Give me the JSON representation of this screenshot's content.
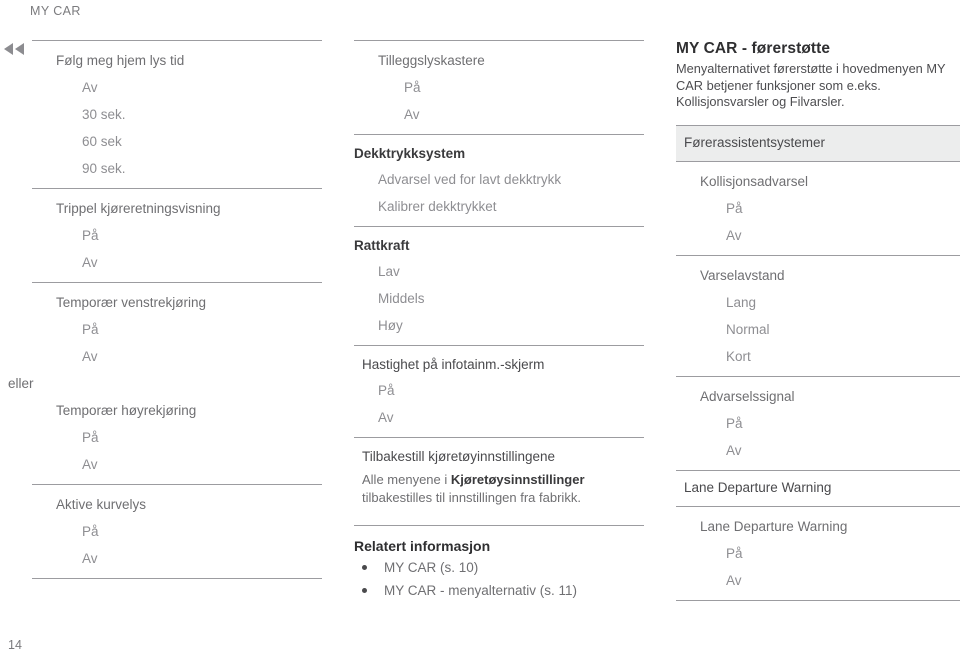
{
  "running_header": "MY CAR",
  "margin_icon": "double-left-chevron-icon",
  "folio": "14",
  "colors": {
    "rule": "#9c9ca0",
    "band_bg": "#eceded",
    "body_text": "#6f6f72",
    "sub_text": "#8e8e92",
    "heading_text": "#2f2f31"
  },
  "column_left": {
    "blocks": [
      {
        "title": "Følg meg hjem lys tid",
        "options": [
          "Av",
          "30 sek.",
          "60 sek",
          "90 sek."
        ]
      },
      {
        "title": "Trippel kjøreretningsvisning",
        "options": [
          "På",
          "Av"
        ]
      },
      {
        "title": "Temporær venstrekjøring",
        "options": [
          "På",
          "Av"
        ],
        "connector": "eller",
        "title2": "Temporær høyrekjøring",
        "options2": [
          "På",
          "Av"
        ]
      },
      {
        "title": "Aktive kurvelys",
        "options": [
          "På",
          "Av"
        ]
      }
    ]
  },
  "column_middle": {
    "blocks": [
      {
        "kind": "plain",
        "title": "Tilleggslyskastere",
        "options": [
          "På",
          "Av"
        ]
      },
      {
        "kind": "head",
        "title": "Dekktrykksystem",
        "options": [
          "Advarsel ved for lavt dekktrykk",
          "Kalibrer dekktrykket"
        ]
      },
      {
        "kind": "head",
        "title": "Rattkraft",
        "options": [
          "Lav",
          "Middels",
          "Høy"
        ]
      },
      {
        "kind": "head-light",
        "title": "Hastighet på infotainm.-skjerm",
        "options": [
          "På",
          "Av"
        ]
      },
      {
        "kind": "head-light",
        "title": "Tilbakestill kjøretøyinnstillingene",
        "description_pre": "Alle menyene i ",
        "description_bold": "Kjøretøysinnstillinger",
        "description_post": " tilbakestilles til innstillingen fra fabrikk."
      }
    ],
    "related": {
      "title": "Relatert informasjon",
      "items": [
        "MY CAR (s. 10)",
        "MY CAR - menyalternativ (s. 11)"
      ]
    }
  },
  "column_right": {
    "article_title": "MY CAR - førerstøtte",
    "article_intro": "Menyalternativet førerstøtte i hovedmenyen MY CAR betjener funksjoner som e.eks. Kollisjonsvarsler og Filvarsler.",
    "band_label": "Førerassistentsystemer",
    "blocks": [
      {
        "title": "Kollisjonsadvarsel",
        "options": [
          "På",
          "Av"
        ]
      },
      {
        "title": "Varselavstand",
        "options": [
          "Lang",
          "Normal",
          "Kort"
        ]
      },
      {
        "title": "Advarselssignal",
        "options": [
          "På",
          "Av"
        ]
      }
    ],
    "band_label2": "Lane Departure Warning",
    "blocks2": [
      {
        "title": "Lane Departure Warning",
        "options": [
          "På",
          "Av"
        ]
      }
    ]
  }
}
